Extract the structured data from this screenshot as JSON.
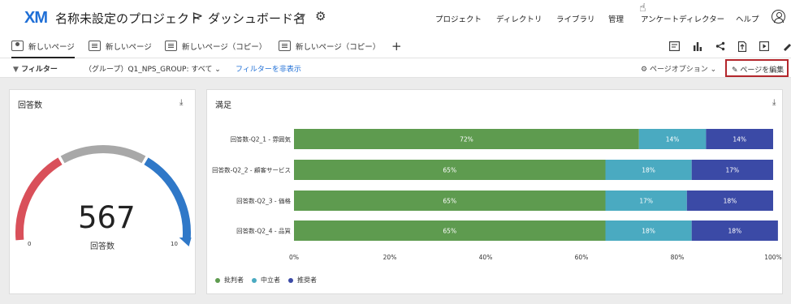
{
  "header": {
    "logo": "XM",
    "project_title": "名称未設定のプロジェクト",
    "separator": ">",
    "dashboard_title": "ダッシュボード名",
    "nav": [
      "プロジェクト",
      "ディレクトリ",
      "ライブラリ",
      "管理",
      "アンケートディレクター",
      "ヘルプ"
    ]
  },
  "tabs": [
    {
      "label": "新しいページ",
      "active": true
    },
    {
      "label": "新しいページ",
      "active": false
    },
    {
      "label": "新しいページ（コピー）",
      "active": false
    },
    {
      "label": "新しいページ（コピー）",
      "active": false
    }
  ],
  "tab_add": "+",
  "toolbar_icons": [
    "layout-icon",
    "bar-chart-icon",
    "share-icon",
    "export-icon",
    "present-icon",
    "more-icon"
  ],
  "filterbar": {
    "label": "フィルター",
    "value": "（グループ）Q1_NPS_GROUP: すべて ⌄",
    "hide": "フィルターを非表示",
    "page_options": "ページオプション ⌄",
    "edit_page": "ページを編集"
  },
  "gauge_widget": {
    "title": "回答数",
    "value": "567",
    "label": "回答数",
    "min": "0",
    "max": "10",
    "colors": {
      "low": "#d9505a",
      "mid": "#a8a8a8",
      "high": "#2f78c8"
    }
  },
  "bar_widget": {
    "title": "満足"
  },
  "chart_data": {
    "type": "bar",
    "orientation": "horizontal",
    "stacked": true,
    "categories": [
      "回答数-Q2_1 - 雰囲気",
      "回答数-Q2_2 - 顧客サービス",
      "回答数-Q2_3 - 価格",
      "回答数-Q2_4 - 品質"
    ],
    "series": [
      {
        "name": "批判者",
        "color": "#5e9b4f",
        "values": [
          72,
          65,
          65,
          65
        ]
      },
      {
        "name": "中立者",
        "color": "#4aaac1",
        "values": [
          14,
          18,
          17,
          18
        ]
      },
      {
        "name": "推奨者",
        "color": "#3b4aa6",
        "values": [
          14,
          17,
          18,
          18
        ]
      }
    ],
    "data_labels": [
      [
        "72%",
        "14%",
        "14%"
      ],
      [
        "65%",
        "18%",
        "17%"
      ],
      [
        "65%",
        "17%",
        "18%"
      ],
      [
        "65%",
        "18%",
        "18%"
      ]
    ],
    "x_ticks": [
      "0%",
      "20%",
      "40%",
      "60%",
      "80%",
      "100%"
    ],
    "xlim": [
      0,
      100
    ],
    "legend_position": "bottom-left",
    "grid": false
  }
}
